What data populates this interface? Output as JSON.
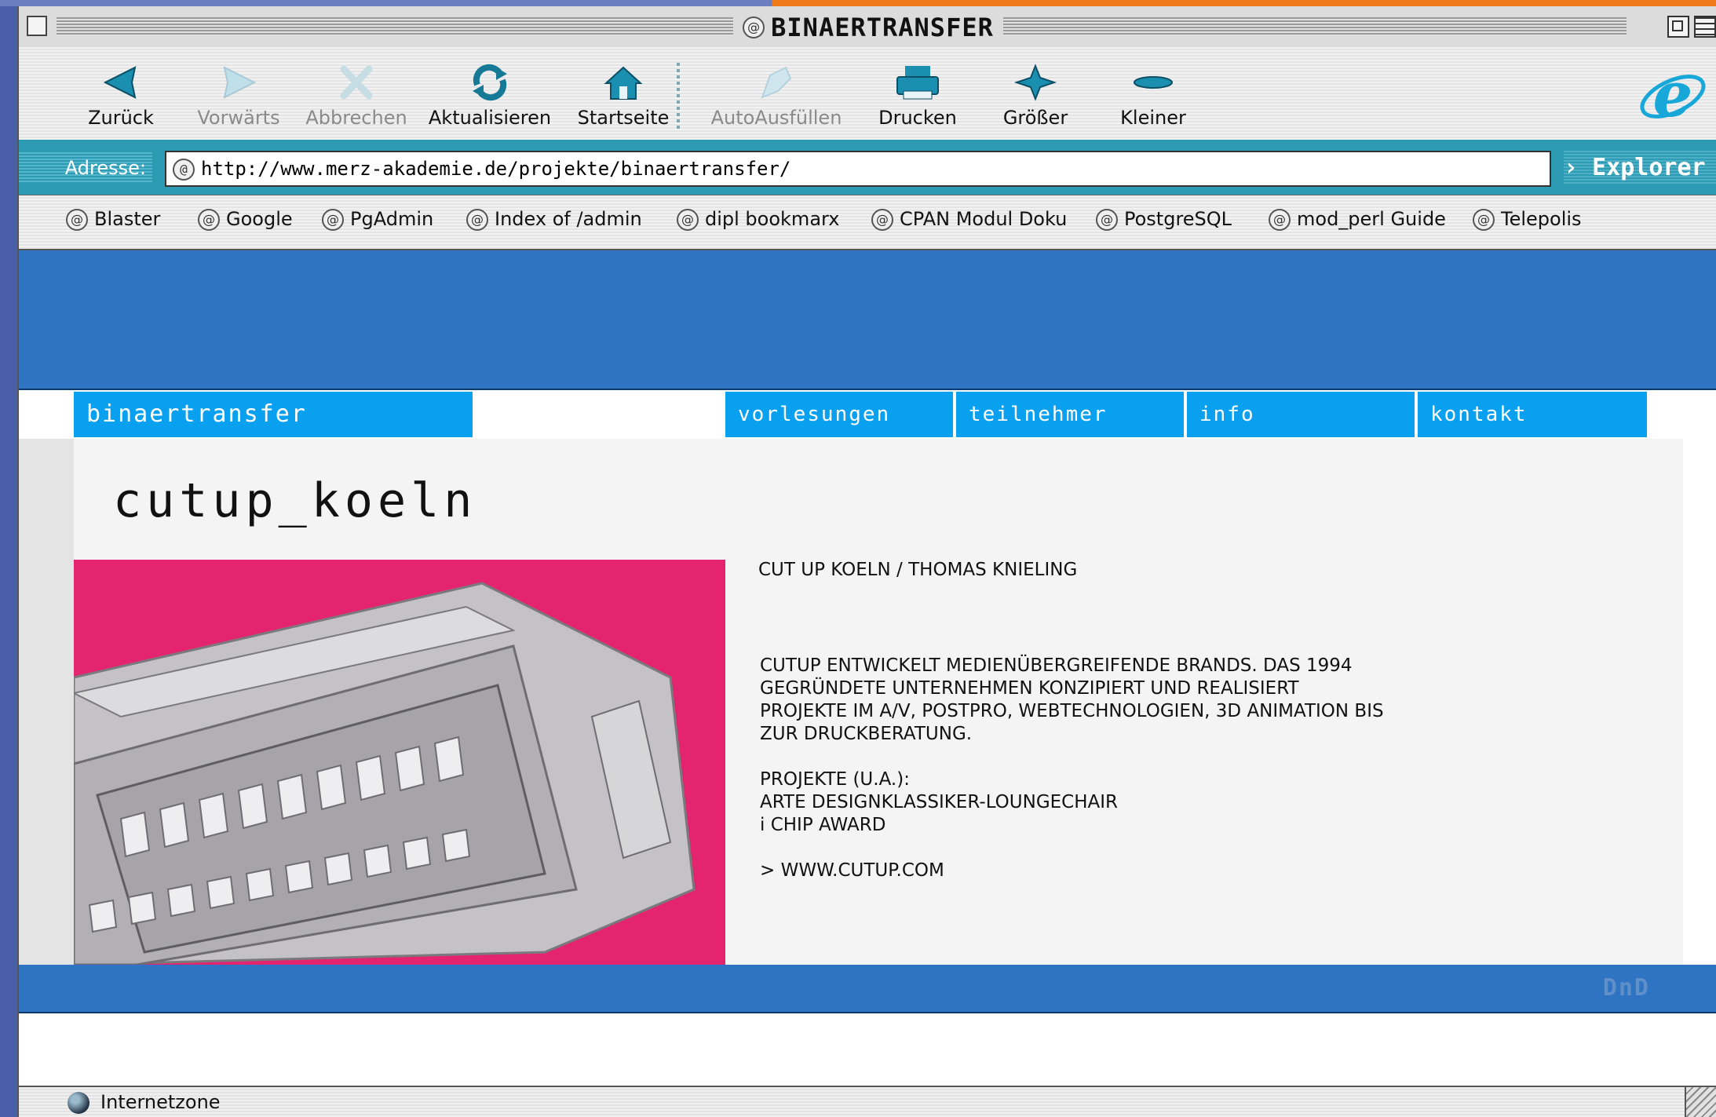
{
  "window": {
    "title": "BINAERTRANSFER"
  },
  "toolbar": {
    "buttons": [
      {
        "label": "Zurück",
        "icon": "back-arrow-icon",
        "enabled": true
      },
      {
        "label": "Vorwärts",
        "icon": "forward-arrow-icon",
        "enabled": false
      },
      {
        "label": "Abbrechen",
        "icon": "stop-x-icon",
        "enabled": false
      },
      {
        "label": "Aktualisieren",
        "icon": "refresh-icon",
        "enabled": true
      },
      {
        "label": "Startseite",
        "icon": "home-icon",
        "enabled": true
      },
      {
        "label": "AutoAusfüllen",
        "icon": "autofill-icon",
        "enabled": false
      },
      {
        "label": "Drucken",
        "icon": "printer-icon",
        "enabled": true
      },
      {
        "label": "Größer",
        "icon": "larger-text-icon",
        "enabled": true
      },
      {
        "label": "Kleiner",
        "icon": "smaller-text-icon",
        "enabled": true
      }
    ]
  },
  "address": {
    "label": "Adresse:",
    "url": "http://www.merz-akademie.de/projekte/binaertransfer/",
    "explorer_label": "› Explorer"
  },
  "favorites": [
    "Blaster",
    "Google",
    "PgAdmin",
    "Index of /admin",
    "dipl bookmarx",
    "CPAN Modul Doku",
    "PostgreSQL",
    "mod_perl Guide",
    "Telepolis"
  ],
  "site": {
    "brand": "binaertransfer",
    "nav": [
      "vorlesungen",
      "teilnehmer",
      "info",
      "kontakt"
    ],
    "page_title": "cutup_koeln",
    "heading": "CUT UP KOELN / THOMAS KNIELING",
    "paragraph_lines": [
      "CUTUP ENTWICKELT MEDIENÜBERGREIFENDE BRANDS. DAS 1994",
      "GEGRÜNDETE UNTERNEHMEN KONZIPIERT UND REALISIERT",
      "PROJEKTE IM A/V, POSTPRO, WEBTECHNOLOGIEN, 3D ANIMATION BIS",
      "ZUR DRUCKBERATUNG."
    ],
    "projects_lines": [
      "PROJEKTE (U.A.):",
      "ARTE DESIGNKLASSIKER-LOUNGECHAIR",
      "i CHIP AWARD"
    ],
    "link": "> WWW.CUTUP.COM",
    "footer_logo": "DnD"
  },
  "status": {
    "zone": "Internetzone"
  },
  "colors": {
    "banner": "#2e74c2",
    "nav": "#0aa0f0",
    "hero": "#e4246e",
    "address_bar": "#2e9bb4"
  }
}
